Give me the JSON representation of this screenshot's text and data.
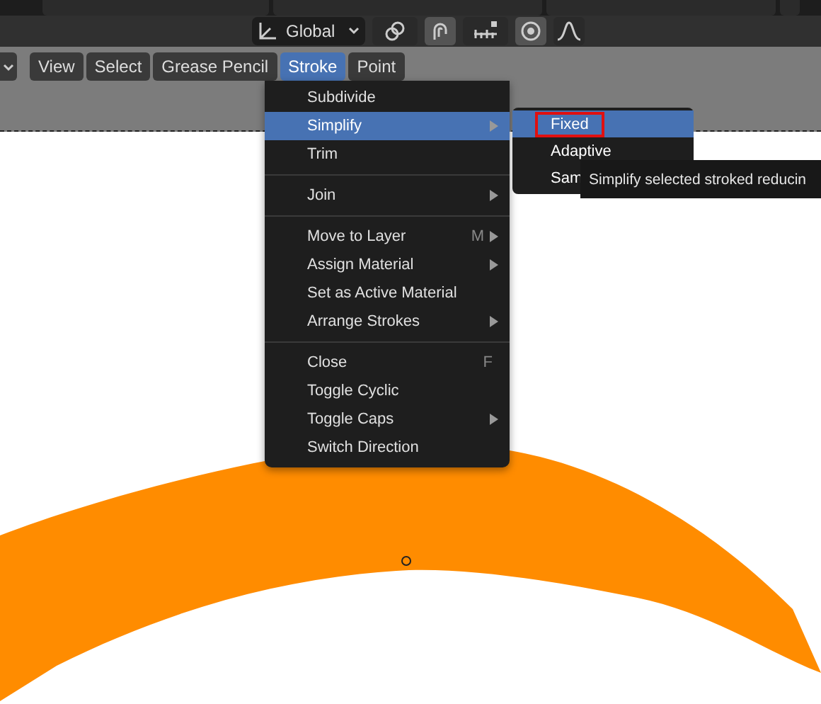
{
  "header_tools": {
    "orientation": "Global",
    "buttons": [
      {
        "kind": "pivot",
        "on": false
      },
      {
        "kind": "snap",
        "on": true
      },
      {
        "kind": "increment",
        "on": false
      },
      {
        "kind": "proportional",
        "on": true
      },
      {
        "kind": "falloff",
        "on": false
      }
    ]
  },
  "menu_bar": [
    {
      "label": "View",
      "selected": false
    },
    {
      "label": "Select",
      "selected": false
    },
    {
      "label": "Grease Pencil",
      "selected": false
    },
    {
      "label": "Stroke",
      "selected": true
    },
    {
      "label": "Point",
      "selected": false
    }
  ],
  "menu": [
    {
      "kind": "item",
      "label": "Subdivide",
      "selected": false,
      "submenu": false
    },
    {
      "kind": "item",
      "label": "Simplify",
      "selected": true,
      "submenu": true
    },
    {
      "kind": "item",
      "label": "Trim",
      "selected": false,
      "submenu": false
    },
    {
      "kind": "separator"
    },
    {
      "kind": "item",
      "label": "Join",
      "selected": false,
      "submenu": true
    },
    {
      "kind": "separator"
    },
    {
      "kind": "item",
      "label": "Move to Layer",
      "selected": false,
      "submenu": true,
      "shortcut": "M"
    },
    {
      "kind": "item",
      "label": "Assign Material",
      "selected": false,
      "submenu": true
    },
    {
      "kind": "item",
      "label": "Set as Active Material",
      "selected": false,
      "submenu": false
    },
    {
      "kind": "item",
      "label": "Arrange Strokes",
      "selected": false,
      "submenu": true
    },
    {
      "kind": "separator"
    },
    {
      "kind": "item",
      "label": "Close",
      "selected": false,
      "submenu": false,
      "shortcut": "F"
    },
    {
      "kind": "item",
      "label": "Toggle Cyclic",
      "selected": false,
      "submenu": false
    },
    {
      "kind": "item",
      "label": "Toggle Caps",
      "selected": false,
      "submenu": true
    },
    {
      "kind": "item",
      "label": "Switch Direction",
      "selected": false,
      "submenu": false
    }
  ],
  "submenu": [
    {
      "label": "Fixed",
      "selected": true,
      "outlined": true
    },
    {
      "label": "Adaptive",
      "selected": false,
      "outlined": false
    },
    {
      "label": "Sam",
      "selected": false,
      "outlined": false
    }
  ],
  "tooltip": "Simplify selected stroked reducin"
}
